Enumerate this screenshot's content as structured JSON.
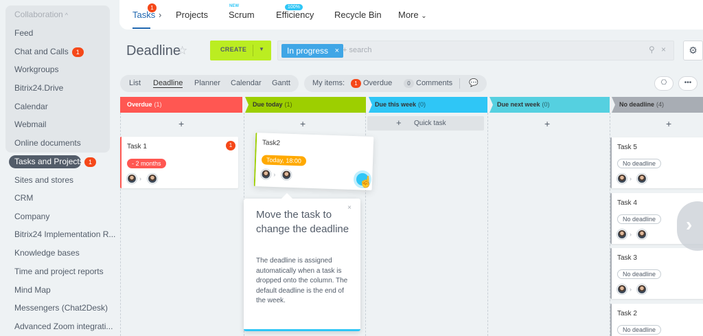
{
  "sidebar": {
    "group_title": "Collaboration",
    "items": [
      {
        "label": "Feed"
      },
      {
        "label": "Chat and Calls",
        "counter": "1"
      },
      {
        "label": "Workgroups"
      },
      {
        "label": "Bitrix24.Drive"
      },
      {
        "label": "Calendar"
      },
      {
        "label": "Webmail"
      },
      {
        "label": "Online documents"
      },
      {
        "label": "Tasks and Projects",
        "counter": "1",
        "active": true
      },
      {
        "label": "Sites and stores"
      },
      {
        "label": "CRM"
      },
      {
        "label": "Company"
      },
      {
        "label": "Bitrix24 Implementation R..."
      },
      {
        "label": "Knowledge bases"
      },
      {
        "label": "Time and project reports"
      },
      {
        "label": "Mind Map"
      },
      {
        "label": "Messengers (Chat2Desk)"
      },
      {
        "label": "Advanced Zoom integrati..."
      }
    ]
  },
  "topnav": {
    "tasks": "Tasks",
    "tasks_badge": "1",
    "projects": "Projects",
    "scrum": "Scrum",
    "scrum_tag": "NEW",
    "efficiency": "Efficiency",
    "efficiency_pill": "100%",
    "recycle_bin": "Recycle Bin",
    "more": "More"
  },
  "header": {
    "title": "Deadline",
    "create_label": "CREATE",
    "filter_chip": "In progress",
    "search_placeholder": "+ search"
  },
  "views": {
    "items": [
      "List",
      "Deadline",
      "Planner",
      "Calendar",
      "Gantt"
    ],
    "active": "Deadline"
  },
  "my_items": {
    "label": "My items:",
    "overdue_count": "1",
    "overdue_label": "Overdue",
    "comments_count": "0",
    "comments_label": "Comments"
  },
  "columns": [
    {
      "title": "Overdue",
      "count": "(1)",
      "color": "#ff5752"
    },
    {
      "title": "Due today",
      "count": "(1)",
      "color": "#9dcf00"
    },
    {
      "title": "Due this week",
      "count": "(0)",
      "color": "#2fc6f6"
    },
    {
      "title": "Due next week",
      "count": "(0)",
      "color": "#55d0e0"
    },
    {
      "title": "No deadline",
      "count": "(4)",
      "color": "#a8adb4"
    }
  ],
  "quick_task": "Quick task",
  "cards": {
    "task1": {
      "title": "Task 1",
      "badge": "1",
      "deadline": "- 2 months"
    },
    "task2": {
      "title": "Task2",
      "deadline": "Today, 18:00"
    },
    "task5": {
      "title": "Task 5",
      "deadline": "No deadline"
    },
    "task4": {
      "title": "Task 4",
      "deadline": "No deadline"
    },
    "task3": {
      "title": "Task 3",
      "deadline": "No deadline"
    },
    "task2b": {
      "title": "Task 2",
      "deadline": "No deadline"
    }
  },
  "tooltip": {
    "title": "Move the task to change the deadline",
    "body": "The deadline is assigned automatically when a task is dropped onto the column. The default deadline is the end of the week."
  },
  "icons": {
    "star": "star-icon",
    "gear": "gear-icon",
    "search": "search-icon",
    "robot": "robot-icon",
    "more": "more-icon",
    "chat": "chat-icon",
    "hand": "hand-cursor-icon"
  }
}
